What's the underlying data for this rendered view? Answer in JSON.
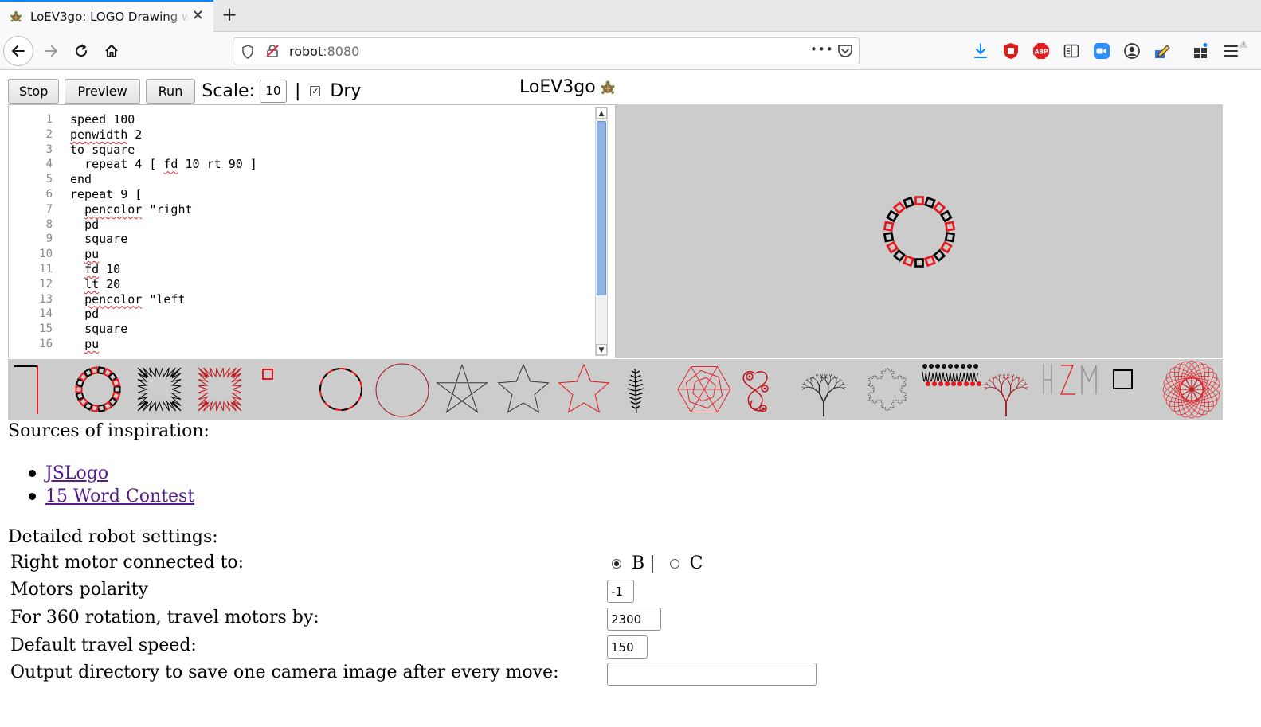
{
  "browser": {
    "tab_title": "LoEV3go: LOGO Drawing with EV3",
    "tab_close": "✕",
    "new_tab": "+",
    "url_host": "robot",
    "url_port": ":8080",
    "url_more": "•••"
  },
  "toolbar": {
    "stop_label": "Stop",
    "preview_label": "Preview",
    "run_label": "Run",
    "scale_label": "Scale:",
    "scale_value": "10",
    "separator": "|",
    "dry_label": "Dry",
    "dry_checked": true,
    "title": "LoEV3go"
  },
  "editor": {
    "lines": [
      {
        "n": "1",
        "text": "speed 100"
      },
      {
        "n": "2",
        "text": "penwidth 2"
      },
      {
        "n": "3",
        "text": "to square"
      },
      {
        "n": "4",
        "text": "  repeat 4 [ fd 10 rt 90 ]"
      },
      {
        "n": "5",
        "text": "end"
      },
      {
        "n": "6",
        "text": "repeat 9 ["
      },
      {
        "n": "7",
        "text": "  pencolor \"right"
      },
      {
        "n": "8",
        "text": "  pd"
      },
      {
        "n": "9",
        "text": "  square"
      },
      {
        "n": "10",
        "text": "  pu"
      },
      {
        "n": "11",
        "text": "  fd 10"
      },
      {
        "n": "12",
        "text": "  lt 20"
      },
      {
        "n": "13",
        "text": "  pencolor \"left"
      },
      {
        "n": "14",
        "text": "  pd"
      },
      {
        "n": "15",
        "text": "  square"
      },
      {
        "n": "16",
        "text": "  pu"
      }
    ]
  },
  "colors": {
    "right_pen": "#e8161b",
    "left_pen": "#000000",
    "canvas_bg": "#cccccc",
    "link": "#551a8b"
  },
  "sources": {
    "title": "Sources of inspiration:",
    "links": [
      "JSLogo",
      "15 Word Contest"
    ]
  },
  "settings": {
    "title": "Detailed robot settings:",
    "right_motor_label": "Right motor connected to:",
    "option_b": "B",
    "option_sep": "|",
    "option_c": "C",
    "selected": "B",
    "polarity_label": "Motors polarity",
    "polarity_value": "-1",
    "rotation_label": "For 360 rotation, travel motors by:",
    "rotation_value": "2300",
    "speed_label": "Default travel speed:",
    "speed_value": "150",
    "output_label": "Output directory to save one camera image after every move:",
    "output_value": ""
  }
}
